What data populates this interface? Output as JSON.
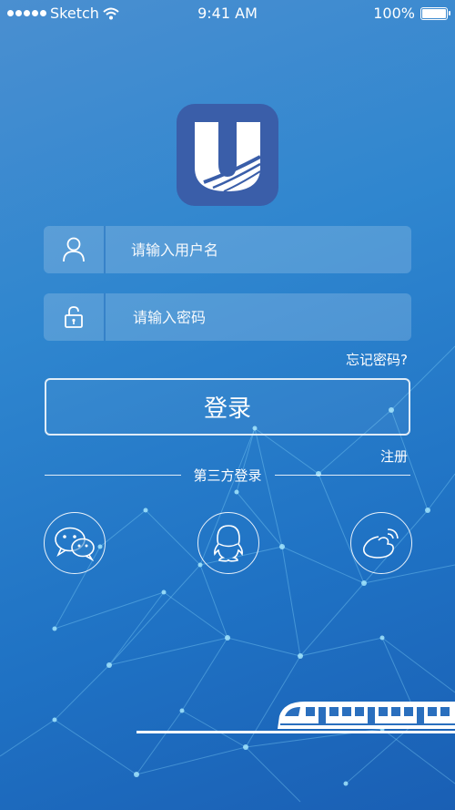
{
  "status_bar": {
    "carrier": "Sketch",
    "time": "9:41 AM",
    "battery": "100%"
  },
  "login_form": {
    "username_placeholder": "请输入用户名",
    "password_placeholder": "请输入密码",
    "forgot_password": "忘记密码?",
    "login_button": "登录",
    "register": "注册"
  },
  "third_party": {
    "title": "第三方登录",
    "providers": [
      "wechat-icon",
      "qq-icon",
      "weibo-icon"
    ]
  },
  "colors": {
    "logo_bg": "#3a5ea9",
    "bg_top": "#4a8fd0",
    "bg_bottom": "#1a5fb4"
  }
}
